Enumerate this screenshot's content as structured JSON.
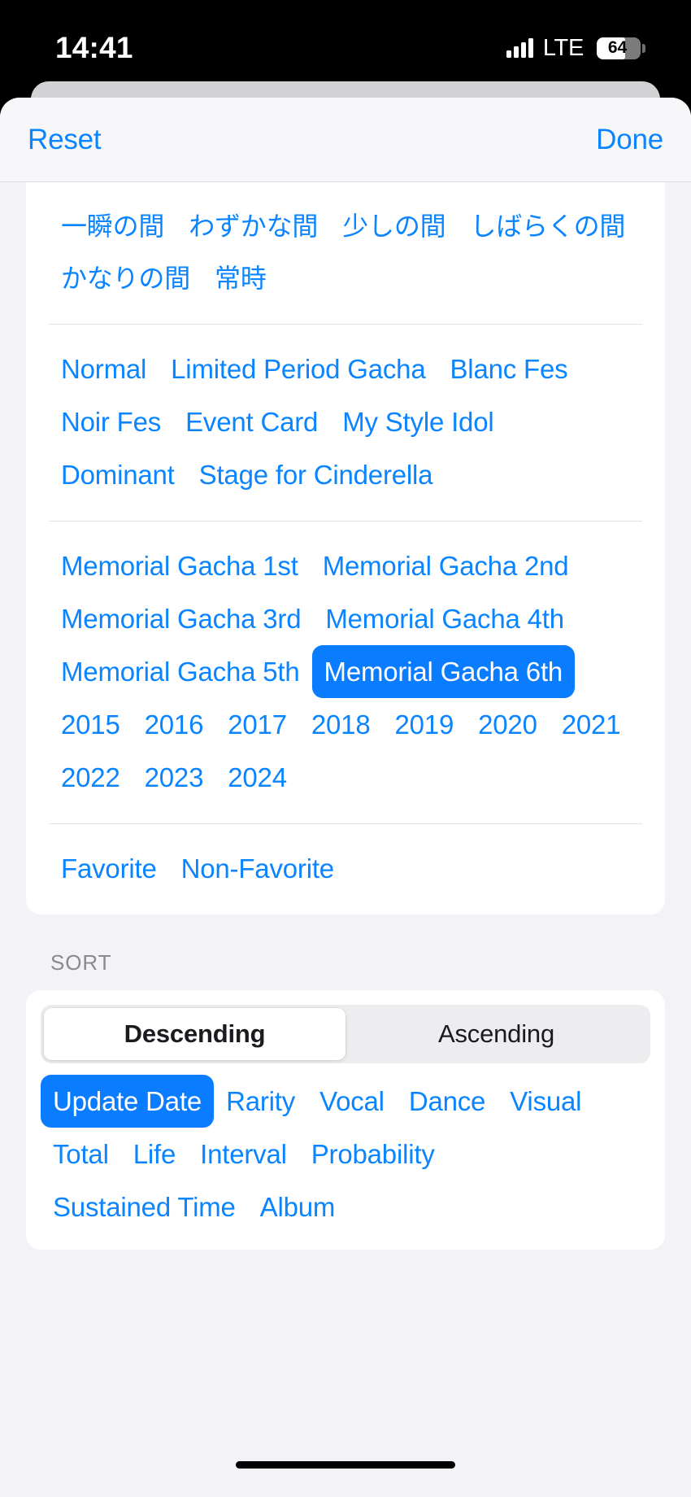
{
  "status_bar": {
    "time": "14:41",
    "network": "LTE",
    "battery_percent": "64",
    "battery_level": 64,
    "signal_icon": "cellular-signal-icon",
    "battery_icon": "battery-icon"
  },
  "sheet": {
    "reset_label": "Reset",
    "done_label": "Done"
  },
  "filters": {
    "groups": [
      {
        "name": "sustained-time",
        "chips": [
          {
            "label": "一瞬の間",
            "selected": false
          },
          {
            "label": "わずかな間",
            "selected": false
          },
          {
            "label": "少しの間",
            "selected": false
          },
          {
            "label": "しばらくの間",
            "selected": false
          },
          {
            "label": "かなりの間",
            "selected": false
          },
          {
            "label": "常時",
            "selected": false
          }
        ]
      },
      {
        "name": "card-source",
        "chips": [
          {
            "label": "Normal",
            "selected": false
          },
          {
            "label": "Limited Period Gacha",
            "selected": false
          },
          {
            "label": "Blanc Fes",
            "selected": false
          },
          {
            "label": "Noir Fes",
            "selected": false
          },
          {
            "label": "Event Card",
            "selected": false
          },
          {
            "label": "My Style Idol",
            "selected": false
          },
          {
            "label": "Dominant",
            "selected": false
          },
          {
            "label": "Stage for Cinderella",
            "selected": false
          }
        ]
      },
      {
        "name": "memorial-gacha-and-year",
        "chips": [
          {
            "label": "Memorial Gacha 1st",
            "selected": false
          },
          {
            "label": "Memorial Gacha 2nd",
            "selected": false
          },
          {
            "label": "Memorial Gacha 3rd",
            "selected": false
          },
          {
            "label": "Memorial Gacha 4th",
            "selected": false
          },
          {
            "label": "Memorial Gacha 5th",
            "selected": false
          },
          {
            "label": "Memorial Gacha 6th",
            "selected": true
          },
          {
            "label": "2015",
            "selected": false
          },
          {
            "label": "2016",
            "selected": false
          },
          {
            "label": "2017",
            "selected": false
          },
          {
            "label": "2018",
            "selected": false
          },
          {
            "label": "2019",
            "selected": false
          },
          {
            "label": "2020",
            "selected": false
          },
          {
            "label": "2021",
            "selected": false
          },
          {
            "label": "2022",
            "selected": false
          },
          {
            "label": "2023",
            "selected": false
          },
          {
            "label": "2024",
            "selected": false
          }
        ]
      },
      {
        "name": "favorite",
        "chips": [
          {
            "label": "Favorite",
            "selected": false
          },
          {
            "label": "Non-Favorite",
            "selected": false
          }
        ]
      }
    ]
  },
  "sort": {
    "section_label": "SORT",
    "order_options": [
      {
        "label": "Descending",
        "selected": true
      },
      {
        "label": "Ascending",
        "selected": false
      }
    ],
    "keys": [
      {
        "label": "Update Date",
        "selected": true
      },
      {
        "label": "Rarity",
        "selected": false
      },
      {
        "label": "Vocal",
        "selected": false
      },
      {
        "label": "Dance",
        "selected": false
      },
      {
        "label": "Visual",
        "selected": false
      },
      {
        "label": "Total",
        "selected": false
      },
      {
        "label": "Life",
        "selected": false
      },
      {
        "label": "Interval",
        "selected": false
      },
      {
        "label": "Probability",
        "selected": false
      },
      {
        "label": "Sustained Time",
        "selected": false
      },
      {
        "label": "Album",
        "selected": false
      }
    ]
  },
  "colors": {
    "accent": "#0a84ff",
    "selected_chip_bg": "#0a7cff",
    "sheet_bg": "#f2f2f7",
    "card_bg": "#ffffff",
    "section_label": "#8a8a8e"
  }
}
